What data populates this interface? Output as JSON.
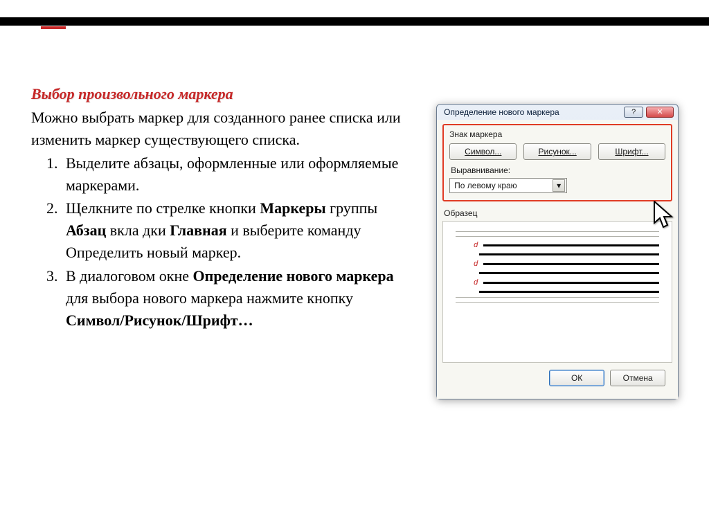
{
  "heading": "Выбор произвольного маркера",
  "intro": "Можно выбрать маркер для созданного ранее списка или изменить маркер существующего списка.",
  "steps": {
    "s1": "Выделите абзацы, оформленные или оформляемые маркерами.",
    "s2a": "Щелкните по стрелке кнопки ",
    "s2b1": "Маркеры",
    "s2c": " группы ",
    "s2b2": "Абзац",
    "s2d": " вкла дки ",
    "s2b3": "Главная",
    "s2e": " и выберите команду Определить новый маркер.",
    "s3a": "В диалоговом окне ",
    "s3b1": "Определение нового маркера",
    "s3c": " для выбора нового маркера нажмите кнопку ",
    "s3b2": "Символ/Рисунок/Шрифт…"
  },
  "dialog": {
    "title": "Определение нового маркера",
    "help_glyph": "?",
    "close_glyph": "✕",
    "group_label": "Знак маркера",
    "btn_symbol": "Символ...",
    "btn_picture": "Рисунок...",
    "btn_font": "Шрифт...",
    "align_label": "Выравнивание:",
    "align_value": "По левому краю",
    "combo_arrow": "▾",
    "preview_label": "Образец",
    "ok": "ОК",
    "cancel": "Отмена",
    "marker_glyph": "d"
  }
}
